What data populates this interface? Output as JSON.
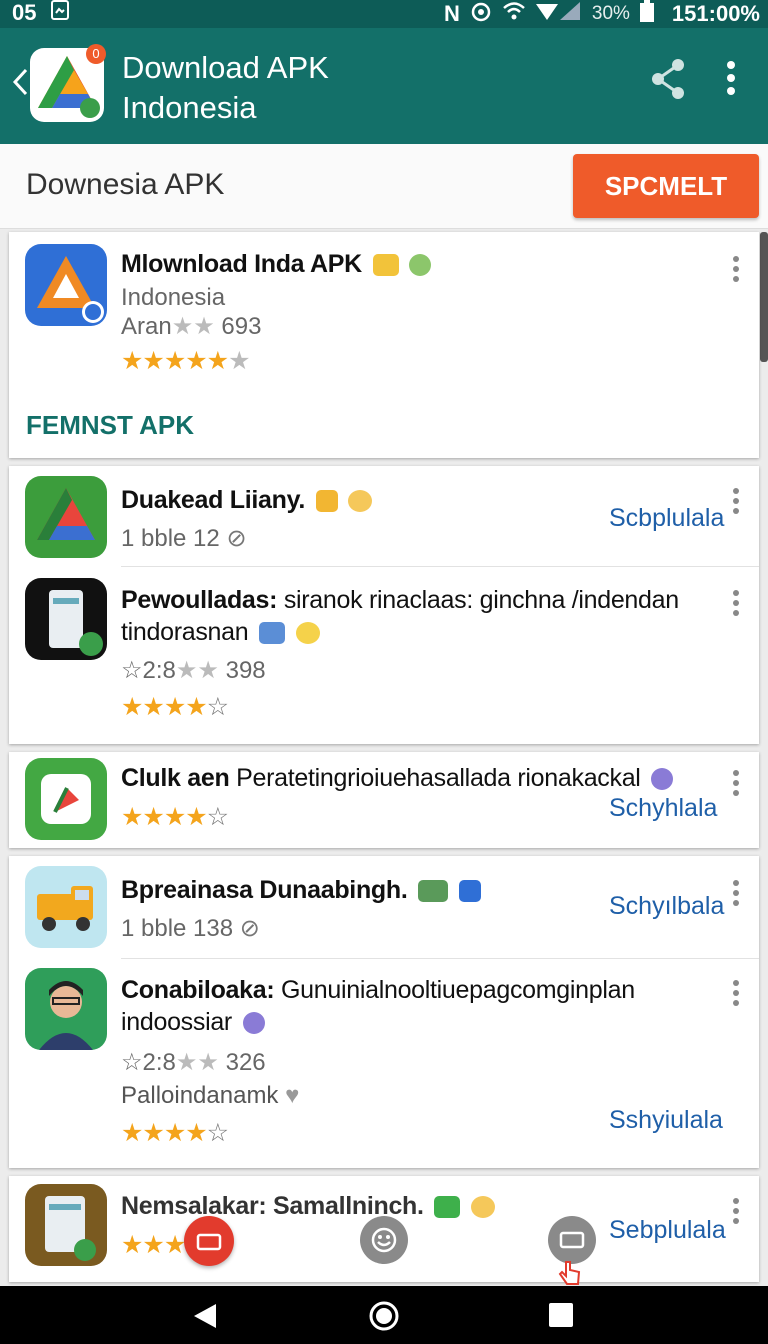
{
  "status": {
    "time_left": "05",
    "battery": "30%",
    "clock": "151:00%"
  },
  "appbar": {
    "title": "Download APK",
    "subtitle": "Indonesia",
    "badge": "0"
  },
  "search": {
    "text": "Downesia APK",
    "button": "SPCMELT"
  },
  "cards": [
    {
      "name": "Mlownload Inda APK",
      "sub1": "Indonesia",
      "sub2_prefix": "Aran",
      "sub2_count": "693",
      "rating": 4.5,
      "section": "FEMNST APK"
    },
    {
      "name": "Duakead Liiany.",
      "sub1": "1 bble 12",
      "action": "Scbplulala"
    },
    {
      "name": "Pewoulladas:",
      "desc1": "siranok rinaclaas: ginchna /indendan",
      "desc2": "tindorasnan",
      "count_prefix": "2:8",
      "count": "398",
      "rating": 3.5
    },
    {
      "name": "Clulk aen",
      "desc1": "Peratetingrioiuehasallada rionakackal",
      "rating": 4,
      "action": "Schyhlala"
    },
    {
      "name": "Bpreainasa Dunaabingh.",
      "sub1": "1 bble 138",
      "action": "Schyılbala"
    },
    {
      "name": "Conabiloaka:",
      "desc1": "Gunuinialnooltiuepagcomginplan",
      "desc2": "indoossiar",
      "count_prefix": "2:8",
      "count": "326",
      "extra": "Palloindanamk",
      "rating": 3.5,
      "action": "Sshyiulala"
    },
    {
      "name": "Nemsalakar: Samallninch.",
      "rating": 3,
      "action": "Sebplulala"
    }
  ],
  "colors": {
    "appbar": "#137069",
    "statusbar": "#0d5c57",
    "accent": "#ef5b2a",
    "link": "#1f5fa8",
    "star": "#f4a41c"
  }
}
